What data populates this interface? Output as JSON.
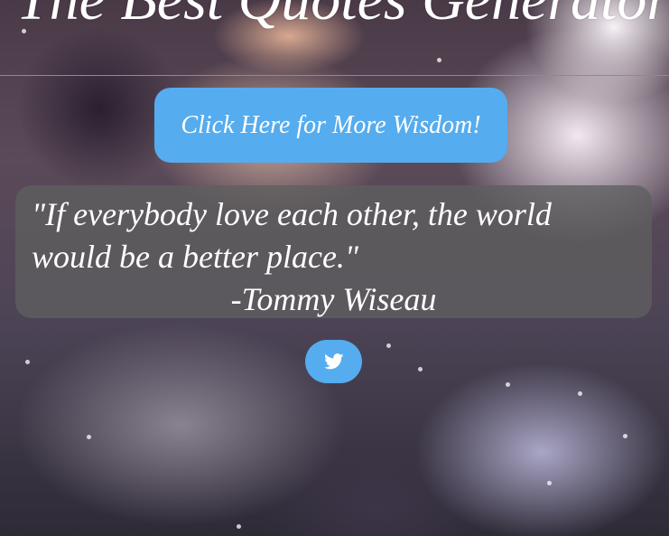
{
  "header": {
    "title": "The Best Quotes Generator"
  },
  "actions": {
    "more_wisdom_label": "Click Here for More Wisdom!"
  },
  "quote": {
    "text": "\"If everybody love each other, the world would be a better place.\"",
    "author": "-Tommy Wiseau"
  },
  "share": {
    "icon": "twitter-icon"
  },
  "colors": {
    "accent": "#55acee",
    "quote_box": "#5f5f5f",
    "text": "#ffffff"
  }
}
